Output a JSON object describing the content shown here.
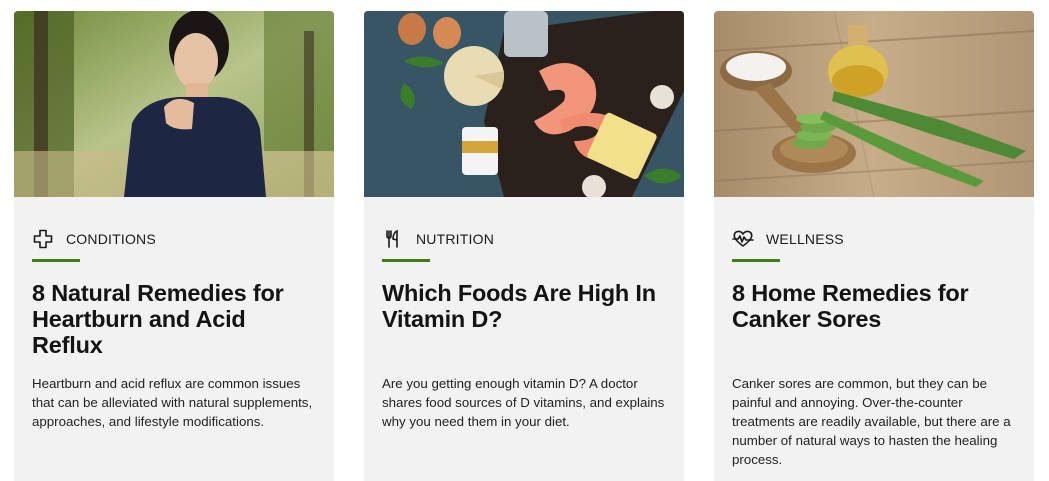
{
  "accent_color": "#3d7d12",
  "cards": [
    {
      "category": "CONDITIONS",
      "category_icon": "medical-cross-icon",
      "title": "8 Natural Remedies for Heartburn and Acid Reflux",
      "description": "Heartburn and acid reflux are common issues that can be alleviated with natural supplements, approaches, and lifestyle modifications.",
      "image": "woman-with-heartburn-photo"
    },
    {
      "category": "NUTRITION",
      "category_icon": "fork-knife-icon",
      "title": "Which Foods Are High In Vitamin D?",
      "description": "Are you getting enough vitamin D? A doctor shares food sources of D vitamins, and explains why you need them in your diet.",
      "image": "vitamin-d-foods-photo"
    },
    {
      "category": "WELLNESS",
      "category_icon": "heart-pulse-icon",
      "title": "8 Home Remedies for Canker Sores",
      "description": "Canker sores are common, but they can be painful and annoying. Over-the-counter treatments are readily available, but there are a number of natural ways to hasten the healing process.",
      "image": "aloe-and-oil-remedies-photo"
    }
  ]
}
